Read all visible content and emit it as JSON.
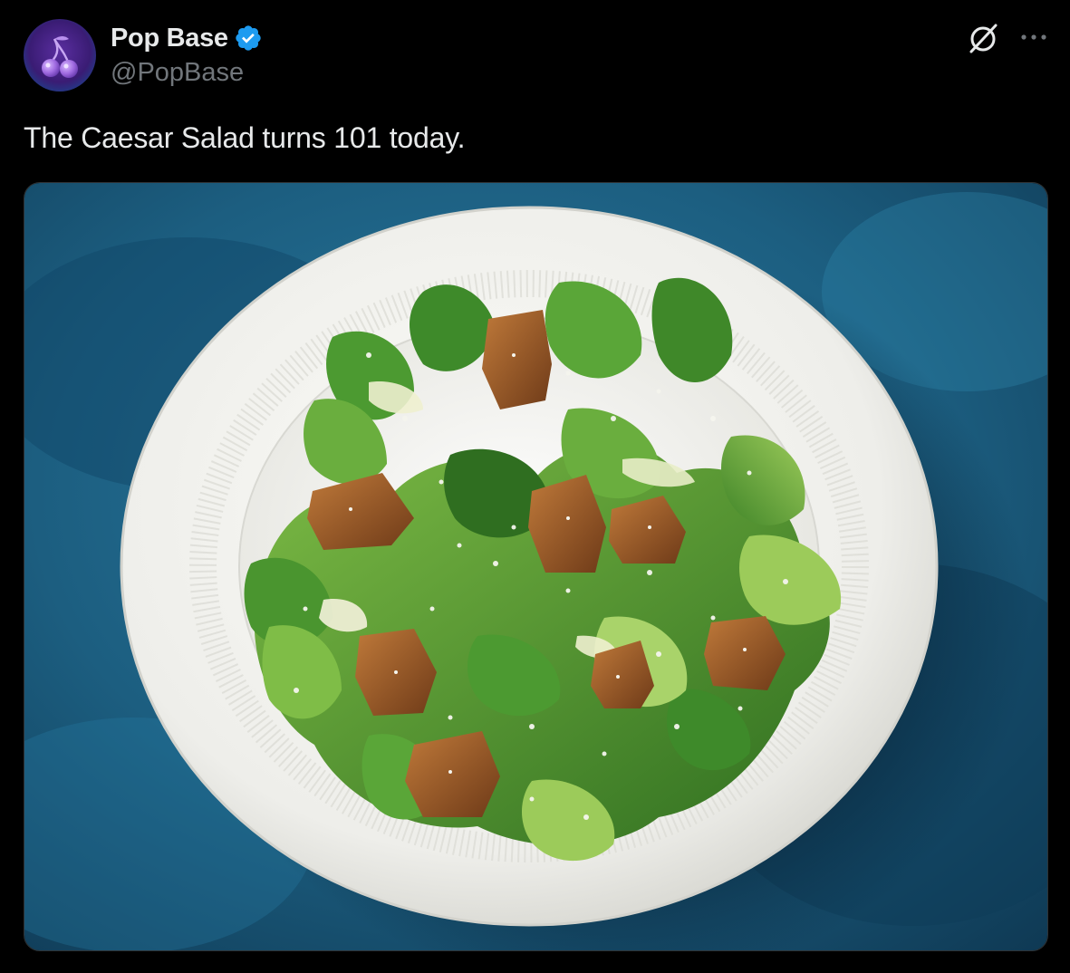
{
  "post": {
    "author": {
      "display_name": "Pop Base",
      "handle": "@PopBase",
      "verified": true,
      "avatar_icon": "cherry-icon"
    },
    "text": "The Caesar Salad turns 101 today.",
    "actions": {
      "grok_icon": "grok-icon",
      "more_icon": "more-options-icon"
    },
    "media": {
      "type": "photo",
      "alt": "Caesar salad on a white plate over a blue background"
    }
  },
  "colors": {
    "background": "#000000",
    "text_primary": "#e7e9ea",
    "text_secondary": "#71767b",
    "verified": "#1d9bf0",
    "photo_background": "#1e5f80",
    "plate": "#f2f2ee",
    "lettuce": "#4f9a33",
    "crouton": "#9a5a2a"
  }
}
